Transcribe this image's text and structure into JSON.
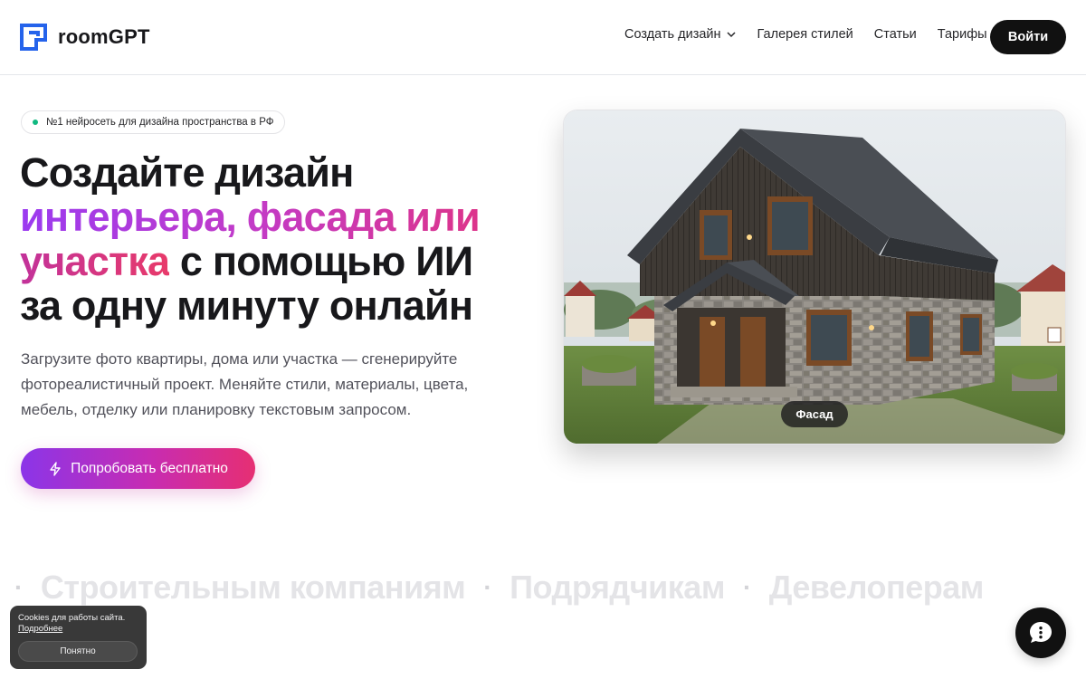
{
  "header": {
    "logo_text": "roomGPT",
    "nav": [
      {
        "label": "Создать дизайн",
        "has_dropdown": true
      },
      {
        "label": "Галерея стилей"
      },
      {
        "label": "Статьи"
      },
      {
        "label": "Тарифы"
      }
    ],
    "login_label": "Войти"
  },
  "hero": {
    "badge": "№1 нейросеть для дизайна пространства в РФ",
    "headline": {
      "line1": "Создайте дизайн",
      "line2_gradient": "интерьера, фасада или",
      "line3_gradient": "участка",
      "line3_rest": " с помощью ИИ",
      "line4": "за одну минуту онлайн"
    },
    "lead": [
      "Загрузите фото квартиры, дома или участка — сгенерируйте",
      "фотореалистичный проект. Меняйте стили, материалы, цвета,",
      "мебель, отделку или планировку текстовым запросом."
    ],
    "cta_label": "Попробовать бесплатно",
    "image_tag": "Фасад"
  },
  "marquee": [
    "Строительным компаниям",
    "Подрядчикам",
    "Девелоперам"
  ],
  "cookie": {
    "text": "Cookies для работы сайта.",
    "link": "Подробнее",
    "button": "Понятно"
  },
  "colors": {
    "accent_gradient": [
      "#8b35e8",
      "#c72cb2",
      "#e62f73"
    ],
    "dark": "#111111",
    "badge_dot": "#10b981"
  },
  "icons": {
    "logo": "logo-icon",
    "dropdown": "chevron-down-icon",
    "cta": "lightning-icon",
    "chat": "chat-icon"
  }
}
